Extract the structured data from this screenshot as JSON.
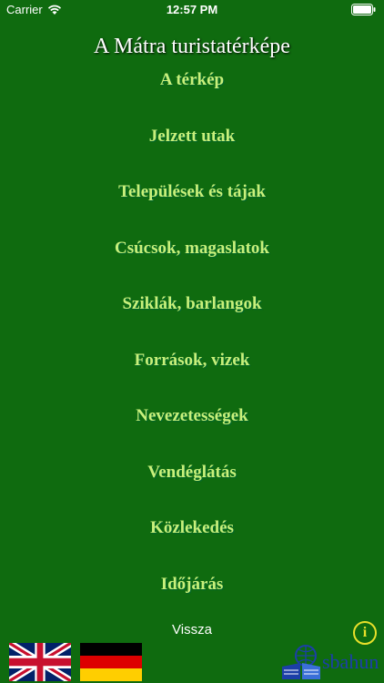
{
  "status": {
    "carrier": "Carrier",
    "time": "12:57 PM"
  },
  "title": "A Mátra turistatérképe",
  "menu": [
    "A térkép",
    "Jelzett utak",
    "Települések és tájak",
    "Csúcsok, magaslatok",
    "Sziklák, barlangok",
    "Források, vizek",
    "Nevezetességek",
    "Vendéglátás",
    "Közlekedés",
    "Időjárás"
  ],
  "back_label": "Vissza",
  "info_label": "i",
  "logo_text": "sbahun",
  "icons": {
    "wifi": "wifi-icon",
    "battery": "battery-icon",
    "info": "info-icon",
    "flag_en": "uk-flag-icon",
    "flag_de": "german-flag-icon"
  },
  "colors": {
    "background": "#0f6b0f",
    "menu_text": "#c8f07a",
    "title_text": "#ffffff",
    "info_accent": "#e8e02a",
    "logo_blue": "#1c3fa8"
  }
}
